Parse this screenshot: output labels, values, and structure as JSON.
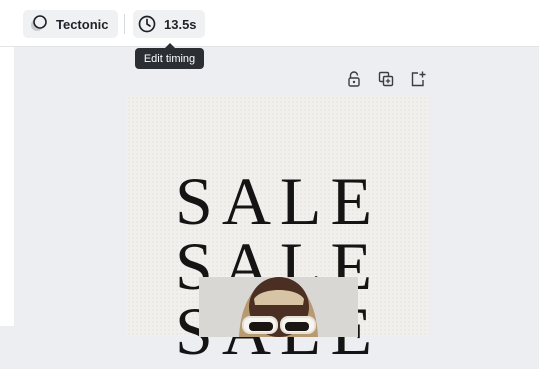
{
  "toolbar": {
    "effect": {
      "label": "Tectonic",
      "icon": "animation-effect-icon"
    },
    "timing": {
      "label": "13.5s",
      "icon": "clock-icon"
    }
  },
  "tooltip": {
    "text": "Edit timing"
  },
  "page_tools": [
    {
      "name": "lock-icon"
    },
    {
      "name": "duplicate-page-icon"
    },
    {
      "name": "add-page-icon"
    }
  ],
  "design": {
    "headline_lines": [
      "SALE",
      "SALE",
      "SALE"
    ],
    "background_color": "#f1f0ec",
    "text_color": "#141414"
  }
}
